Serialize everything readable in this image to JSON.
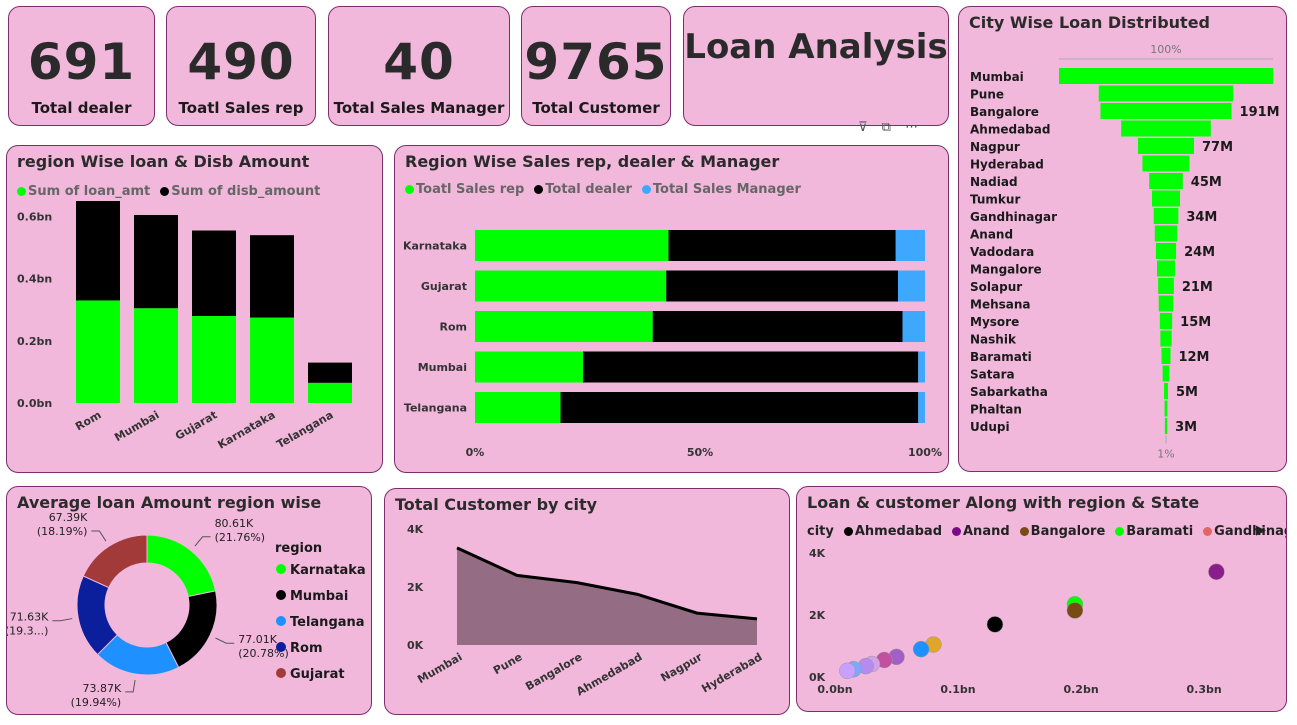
{
  "kpis": [
    {
      "value": "691",
      "label": "Total dealer"
    },
    {
      "value": "490",
      "label": "Toatl Sales rep"
    },
    {
      "value": "40",
      "label": "Total Sales Manager"
    },
    {
      "value": "9765",
      "label": "Total Customer"
    }
  ],
  "dashboard_title": "Loan Analysis",
  "colors": {
    "green": "#00ff00",
    "black": "#000000",
    "blue": "#3ea8ff",
    "card": "#f1b8dc",
    "border": "#7a2f6b"
  },
  "visual_header_icons": [
    "filter-icon",
    "focus-mode-icon",
    "more-options-icon"
  ],
  "chart_data": [
    {
      "id": "region_loan",
      "type": "bar",
      "title": "region Wise loan & Disb Amount",
      "stacked": true,
      "categories": [
        "Rom",
        "Mumbai",
        "Gujarat",
        "Karnataka",
        "Telangana"
      ],
      "series": [
        {
          "name": "Sum of loan_amt",
          "color": "#00ff00",
          "values": [
            0.33,
            0.305,
            0.28,
            0.275,
            0.065
          ]
        },
        {
          "name": "Sum of disb_amount",
          "color": "#000000",
          "values": [
            0.32,
            0.3,
            0.275,
            0.265,
            0.065
          ]
        }
      ],
      "ylim": [
        0,
        0.65
      ],
      "yticks": [
        0,
        0.2,
        0.4,
        0.6
      ],
      "ytick_labels": [
        "0.0bn",
        "0.2bn",
        "0.4bn",
        "0.6bn"
      ],
      "legend": "top-left"
    },
    {
      "id": "region_sales",
      "type": "bar",
      "orientation": "horizontal",
      "stacked": "100%",
      "title": "Region Wise Sales rep, dealer & Manager",
      "categories": [
        "Karnataka",
        "Gujarat",
        "Rom",
        "Mumbai",
        "Telangana"
      ],
      "series": [
        {
          "name": "Toatl Sales rep",
          "color": "#00ff00",
          "values": [
            43,
            42.5,
            39.5,
            24,
            19
          ]
        },
        {
          "name": "Total dealer",
          "color": "#000000",
          "values": [
            50.5,
            51.5,
            55.5,
            74.5,
            79.5
          ]
        },
        {
          "name": "Total Sales Manager",
          "color": "#3ea8ff",
          "values": [
            6.5,
            6,
            5,
            1.5,
            1.5
          ]
        }
      ],
      "xticks": [
        "0%",
        "50%",
        "100%"
      ],
      "legend": "top-left"
    },
    {
      "id": "city_funnel",
      "type": "bar",
      "subtype": "funnel",
      "title": "City Wise Loan Distributed",
      "categories": [
        "Mumbai",
        "Pune",
        "Bangalore",
        "Ahmedabad",
        "Nagpur",
        "Hyderabad",
        "Nadiad",
        "Tumkur",
        "Gandhinagar",
        "Anand",
        "Vadodara",
        "Mangalore",
        "Solapur",
        "Mehsana",
        "Mysore",
        "Nashik",
        "Baramati",
        "Satara",
        "Sabarkatha",
        "Phaltan",
        "Udupi"
      ],
      "values": [
        191,
        120,
        117,
        80,
        50,
        42,
        30,
        25,
        22,
        20,
        18,
        16,
        14,
        13,
        11,
        10,
        8,
        6,
        3.5,
        2.5,
        2
      ],
      "data_labels": [
        "",
        "",
        "191M",
        "",
        "77M",
        "",
        "45M",
        "",
        "34M",
        "",
        "24M",
        "",
        "21M",
        "",
        "15M",
        "",
        "12M",
        "",
        "5M",
        "",
        "3M"
      ],
      "top_label": "100%",
      "bottom_label": "1%"
    },
    {
      "id": "avg_loan_donut",
      "type": "pie",
      "subtype": "donut",
      "title": "Average loan Amount region wise",
      "legend_title": "region",
      "categories": [
        "Karnataka",
        "Mumbai",
        "Telangana",
        "Rom",
        "Gujarat"
      ],
      "values": [
        80.61,
        77.01,
        73.87,
        71.63,
        67.39
      ],
      "colors": [
        "#00ff00",
        "#000000",
        "#1e90ff",
        "#0b1f9c",
        "#a33a3a"
      ],
      "labels": [
        "80.61K",
        "77.01K",
        "73.87K",
        "71.63K",
        "67.39K"
      ],
      "percents": [
        "(21.76%)",
        "(20.78%)",
        "(19.94%)",
        "(19.3...)",
        "(18.19%)"
      ],
      "legend": "right"
    },
    {
      "id": "customer_area",
      "type": "area",
      "title": "Total Customer by city",
      "categories": [
        "Mumbai",
        "Pune",
        "Bangalore",
        "Ahmedabad",
        "Nagpur",
        "Hyderabad"
      ],
      "values": [
        3350,
        2400,
        2150,
        1750,
        1100,
        900
      ],
      "ylim": [
        0,
        4000
      ],
      "yticks": [
        0,
        2000,
        4000
      ],
      "ytick_labels": [
        "0K",
        "2K",
        "4K"
      ],
      "color": "#946c84"
    },
    {
      "id": "loan_customer_scatter",
      "type": "scatter",
      "title": "Loan & customer Along with region & State",
      "legend_label": "city",
      "legend_items": [
        {
          "name": "Ahmedabad",
          "color": "#000000"
        },
        {
          "name": "Anand",
          "color": "#7a0a8a"
        },
        {
          "name": "Bangalore",
          "color": "#7a4a14"
        },
        {
          "name": "Baramati",
          "color": "#00ff00"
        },
        {
          "name": "Gandhinagar",
          "color": "#e06666"
        }
      ],
      "points": [
        {
          "x": 0.31,
          "y": 3400,
          "color": "#8a1e8a"
        },
        {
          "x": 0.195,
          "y": 2350,
          "color": "#00ff00"
        },
        {
          "x": 0.195,
          "y": 2150,
          "color": "#7a4a14"
        },
        {
          "x": 0.13,
          "y": 1700,
          "color": "#000000"
        },
        {
          "x": 0.08,
          "y": 1050,
          "color": "#e0a52a"
        },
        {
          "x": 0.07,
          "y": 900,
          "color": "#1e90ff"
        },
        {
          "x": 0.05,
          "y": 650,
          "color": "#a35fc7"
        },
        {
          "x": 0.04,
          "y": 550,
          "color": "#c24fa0"
        },
        {
          "x": 0.03,
          "y": 420,
          "color": "#d4a0e8"
        },
        {
          "x": 0.025,
          "y": 350,
          "color": "#b48cf0"
        },
        {
          "x": 0.015,
          "y": 250,
          "color": "#7aa8ff"
        },
        {
          "x": 0.01,
          "y": 200,
          "color": "#c8a0ff"
        }
      ],
      "xlim": [
        0,
        0.33
      ],
      "ylim": [
        0,
        4200
      ],
      "xticks": [
        0,
        0.1,
        0.2,
        0.3
      ],
      "xtick_labels": [
        "0.0bn",
        "0.1bn",
        "0.2bn",
        "0.3bn"
      ],
      "yticks": [
        0,
        2000,
        4000
      ],
      "ytick_labels": [
        "0K",
        "2K",
        "4K"
      ]
    }
  ]
}
